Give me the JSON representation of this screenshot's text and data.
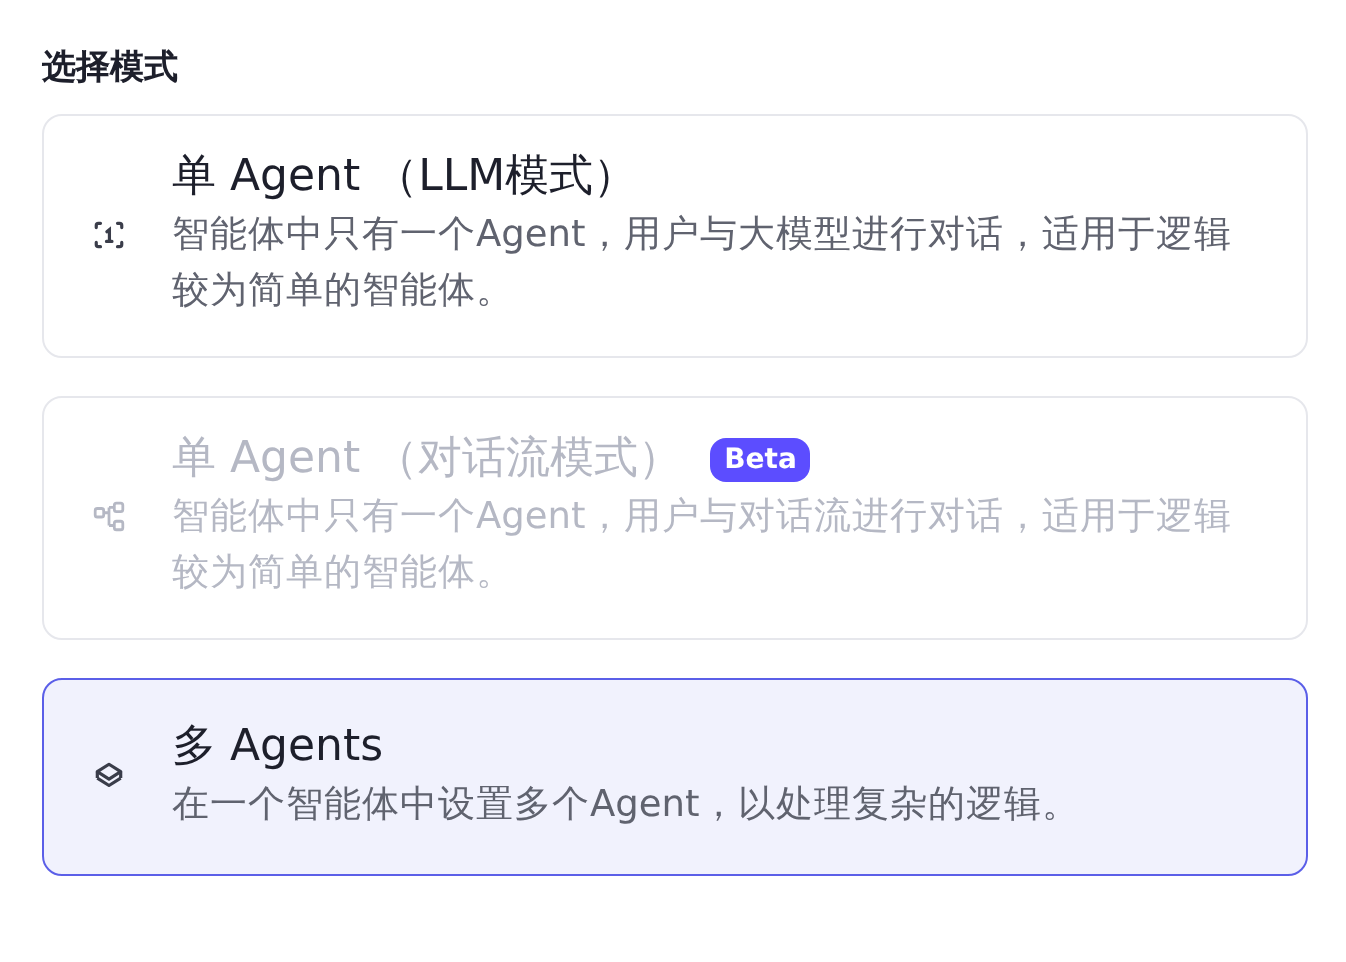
{
  "heading": "选择模式",
  "modes": [
    {
      "title": "单 Agent （LLM模式）",
      "description": "智能体中只有一个Agent，用户与大模型进行对话，适用于逻辑较为简单的智能体。",
      "selected": false,
      "disabled": false
    },
    {
      "title": "单 Agent （对话流模式）",
      "badge": "Beta",
      "description": "智能体中只有一个Agent，用户与对话流进行对话，适用于逻辑较为简单的智能体。",
      "selected": false,
      "disabled": true
    },
    {
      "title": "多 Agents",
      "description": "在一个智能体中设置多个Agent，以处理复杂的逻辑。",
      "selected": true,
      "disabled": false
    }
  ]
}
